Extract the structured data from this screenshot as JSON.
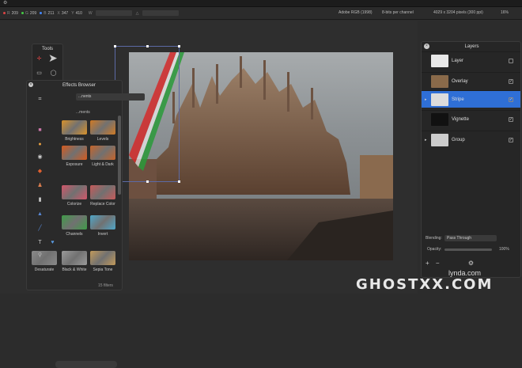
{
  "infobar": {
    "r_label": "R",
    "r_value": "209",
    "g_label": "G",
    "g_value": "209",
    "b_label": "B",
    "b_value": "211",
    "x_label": "X",
    "x_value": "347",
    "y_label": "Y",
    "y_value": "410",
    "w_label": "W",
    "color_profile": "Adobe RGB (1998)",
    "bit_depth": "8-bits per channel",
    "dimensions": "4029 x 3204 pixels (300 ppi)",
    "zoom": "16%"
  },
  "tools": {
    "title": "Tools"
  },
  "effects": {
    "title": "Effects Browser",
    "category": "...nents",
    "subcategory": "...ments",
    "items": [
      {
        "label": "Brightness",
        "color": "#d9922a"
      },
      {
        "label": "Levels",
        "color": "#d07a25"
      },
      {
        "label": "Exposure",
        "color": "#d65a1e"
      },
      {
        "label": "Light & Dark",
        "color": "#c6642a"
      },
      {
        "label": "Colorize",
        "color": "#d2566a"
      },
      {
        "label": "Replace Color",
        "color": "#c75a5a"
      },
      {
        "label": "Channels",
        "color": "#3f9c48"
      },
      {
        "label": "Invert",
        "color": "#4fa6c8"
      },
      {
        "label": "Desaturate",
        "color": "#8a8a8a"
      },
      {
        "label": "Black & White",
        "color": "#9a9a9a"
      },
      {
        "label": "Sepia Tone",
        "color": "#c29a5a"
      }
    ],
    "count": "15 filters"
  },
  "layers": {
    "title": "Layers",
    "items": [
      {
        "name": "Layer",
        "thumb": "#e8e8e8"
      },
      {
        "name": "Overlay",
        "thumb": "#8a6a4a"
      },
      {
        "name": "Stripe",
        "thumb": "#dcdcdc"
      },
      {
        "name": "Vignette",
        "thumb": "#111111"
      },
      {
        "name": "Group",
        "thumb": "#cccccc"
      }
    ],
    "blending_label": "Blending:",
    "blending_value": "Pass Through",
    "opacity_label": "Opacity:",
    "opacity_value": "100%"
  },
  "watermark": {
    "brand": "GHOSTXX.COM",
    "lynda": "lynda.com"
  },
  "colors": {
    "accent": "#2f6fd6",
    "stripe_red": "#d42a2a",
    "stripe_green": "#2a9a3a"
  }
}
